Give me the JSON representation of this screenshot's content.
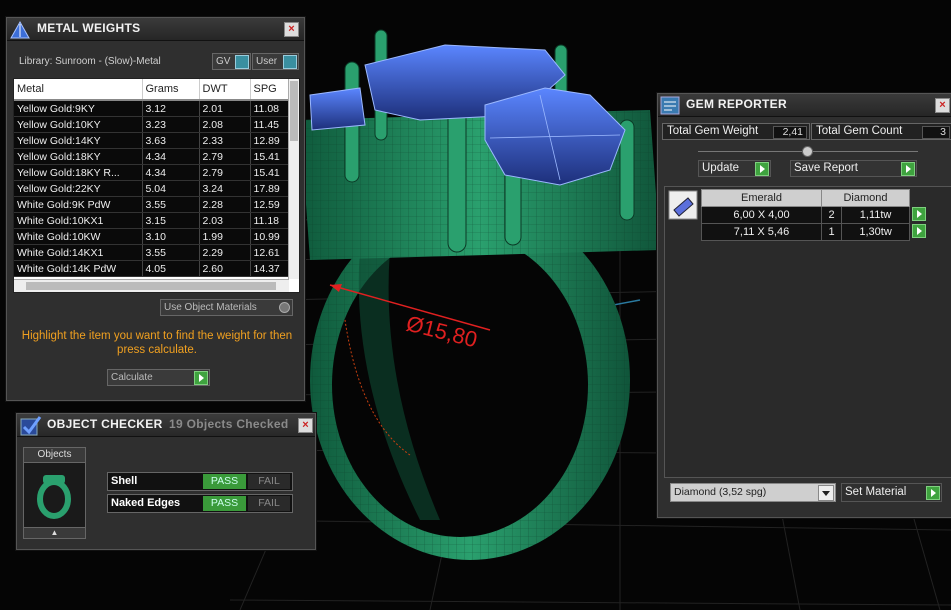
{
  "viewport": {
    "dimension_label": "Ø15,80"
  },
  "metal_weights": {
    "title": "METAL WEIGHTS",
    "close": "×",
    "library_label": "Library: Sunroom - (Slow)-Metal",
    "gv_label": "GV",
    "user_label": "User",
    "columns": [
      "Metal",
      "Grams",
      "DWT",
      "SPG"
    ],
    "rows": [
      [
        "Yellow Gold:9KY",
        "3.12",
        "2.01",
        "11.08"
      ],
      [
        "Yellow Gold:10KY",
        "3.23",
        "2.08",
        "11.45"
      ],
      [
        "Yellow Gold:14KY",
        "3.63",
        "2.33",
        "12.89"
      ],
      [
        "Yellow Gold:18KY",
        "4.34",
        "2.79",
        "15.41"
      ],
      [
        "Yellow Gold:18KY R...",
        "4.34",
        "2.79",
        "15.41"
      ],
      [
        "Yellow Gold:22KY",
        "5.04",
        "3.24",
        "17.89"
      ],
      [
        "White Gold:9K PdW",
        "3.55",
        "2.28",
        "12.59"
      ],
      [
        "White Gold:10KX1",
        "3.15",
        "2.03",
        "11.18"
      ],
      [
        "White Gold:10KW",
        "3.10",
        "1.99",
        "10.99"
      ],
      [
        "White Gold:14KX1",
        "3.55",
        "2.29",
        "12.61"
      ],
      [
        "White Gold:14K PdW",
        "4.05",
        "2.60",
        "14.37"
      ]
    ],
    "use_object_materials": "Use Object Materials",
    "hint": "Highlight the item you want to find the weight for then press calculate.",
    "calculate": "Calculate"
  },
  "object_checker": {
    "title": "OBJECT CHECKER",
    "status": "19  Objects Checked",
    "close": "×",
    "objects_label": "Objects",
    "checks": [
      {
        "name": "Shell",
        "pass": "PASS",
        "fail": "FAIL"
      },
      {
        "name": "Naked Edges",
        "pass": "PASS",
        "fail": "FAIL"
      }
    ]
  },
  "gem_reporter": {
    "title": "GEM REPORTER",
    "close": "×",
    "total_weight_label": "Total Gem Weight",
    "total_weight_value": "2,41",
    "total_count_label": "Total Gem Count",
    "total_count_value": "3",
    "update": "Update",
    "save_report": "Save Report",
    "table_headers": [
      "Emerald",
      "Diamond"
    ],
    "gems": [
      {
        "size": "6,00 X 4,00",
        "count": "2",
        "weight": "1,11tw"
      },
      {
        "size": "7,11 X 5,46",
        "count": "1",
        "weight": "1,30tw"
      }
    ],
    "material_select": "Diamond     (3,52 spg)",
    "set_material": "Set Material"
  },
  "colors": {
    "ring": "#1f8a5f",
    "gem": "#3f66d8",
    "hint": "#f0a020",
    "pass": "#3a9a3a"
  }
}
